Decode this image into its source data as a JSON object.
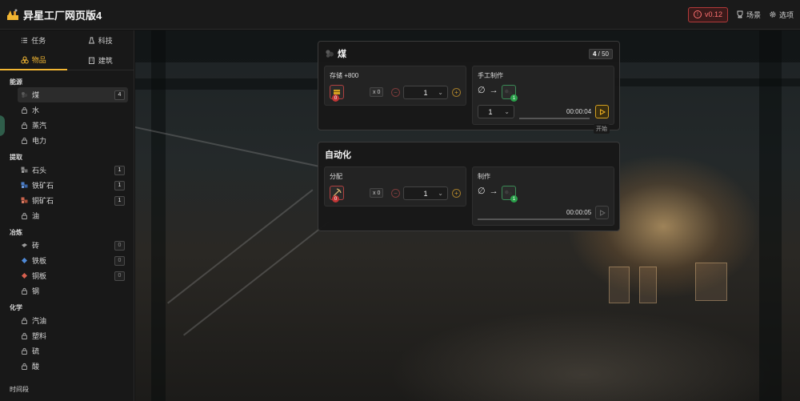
{
  "app": {
    "title": "异星工厂网页版4",
    "version": "v0.12",
    "scene_label": "场景",
    "options_label": "选项"
  },
  "colors": {
    "accent": "#f2b632",
    "danger": "#c03535",
    "ok": "#2aa04a"
  },
  "sidebar": {
    "tabs": [
      {
        "label": "任务",
        "icon": "tasks-icon"
      },
      {
        "label": "科技",
        "icon": "flask-icon"
      },
      {
        "label": "物品",
        "icon": "items-icon",
        "active": true
      },
      {
        "label": "建筑",
        "icon": "building-icon"
      }
    ],
    "categories": [
      {
        "label": "能源",
        "items": [
          {
            "label": "煤",
            "count": "4",
            "icon": "coal-icon",
            "selected": true
          },
          {
            "label": "水",
            "icon": "lock-icon"
          },
          {
            "label": "蒸汽",
            "icon": "lock-icon"
          },
          {
            "label": "电力",
            "icon": "lock-icon"
          }
        ]
      },
      {
        "label": "提取",
        "items": [
          {
            "label": "石头",
            "count": "1",
            "icon": "stone-icon"
          },
          {
            "label": "铁矿石",
            "count": "1",
            "icon": "iron-ore-icon"
          },
          {
            "label": "铜矿石",
            "count": "1",
            "icon": "copper-ore-icon"
          },
          {
            "label": "油",
            "icon": "lock-icon"
          }
        ]
      },
      {
        "label": "冶炼",
        "items": [
          {
            "label": "砖",
            "count": "0",
            "icon": "brick-icon"
          },
          {
            "label": "铁板",
            "count": "0",
            "icon": "iron-plate-icon"
          },
          {
            "label": "铜板",
            "count": "0",
            "icon": "copper-plate-icon"
          },
          {
            "label": "钢",
            "icon": "lock-icon"
          }
        ]
      },
      {
        "label": "化学",
        "items": [
          {
            "label": "汽油",
            "icon": "lock-icon"
          },
          {
            "label": "塑料",
            "icon": "lock-icon"
          },
          {
            "label": "硫",
            "icon": "lock-icon"
          },
          {
            "label": "酸",
            "icon": "lock-icon"
          }
        ]
      },
      {
        "label": "时间段",
        "items": []
      }
    ]
  },
  "resource_panel": {
    "title": "煤",
    "capacity_current": "4",
    "capacity_sep": " / ",
    "capacity_max": "50",
    "storage": {
      "label": "存储 +800",
      "multiplier": "x 0",
      "amount": "1",
      "slot_badge": "0"
    },
    "manual": {
      "label": "手工制作",
      "amount": "1",
      "time": "00:00:04",
      "start_hint": "开始",
      "output_badge": "1"
    }
  },
  "automation_panel": {
    "title": "自动化",
    "distribute": {
      "label": "分配",
      "multiplier": "x 0",
      "amount": "1",
      "slot_badge": "0"
    },
    "produce": {
      "label": "制作",
      "time": "00:00:05",
      "output_badge": "1"
    }
  }
}
